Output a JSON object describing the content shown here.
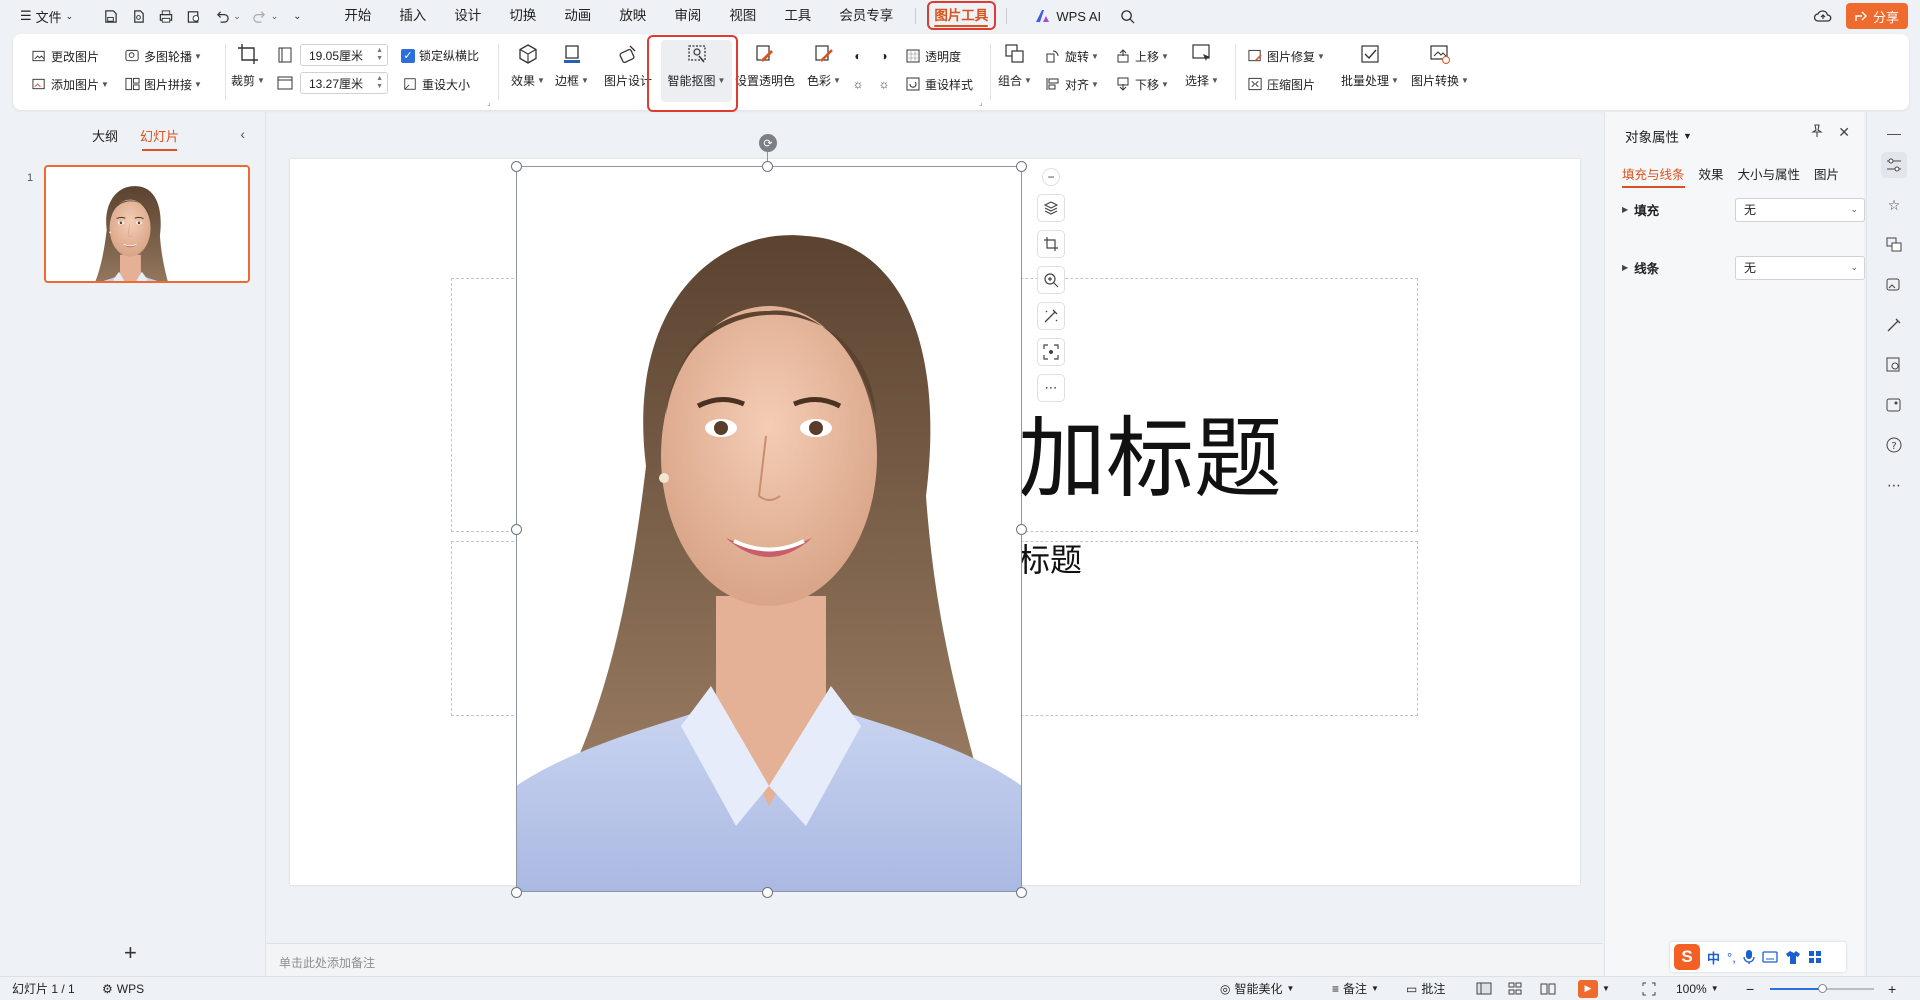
{
  "menubar": {
    "file_label": "文件",
    "tabs": [
      "开始",
      "插入",
      "设计",
      "切换",
      "动画",
      "放映",
      "审阅",
      "视图",
      "工具",
      "会员专享"
    ],
    "picture_tools_tab": "图片工具",
    "wps_ai_label": "WPS AI",
    "share_label": "分享"
  },
  "ribbon": {
    "change_picture": "更改图片",
    "add_picture": "添加图片",
    "multi_outline": "多图轮播",
    "picture_collage": "图片拼接",
    "crop": "裁剪",
    "width_value": "19.05厘米",
    "height_value": "13.27厘米",
    "lock_ratio": "锁定纵横比",
    "reset_size": "重设大小",
    "effects": "效果",
    "border": "边框",
    "picture_design": "图片设计",
    "smart_cutout": "智能抠图",
    "set_transparent_color": "设置透明色",
    "color": "色彩",
    "transparency": "透明度",
    "reset_style": "重设样式",
    "group": "组合",
    "rotate": "旋转",
    "align": "对齐",
    "bring_forward": "上移",
    "send_backward": "下移",
    "select": "选择",
    "picture_repair": "图片修复",
    "compress_picture": "压缩图片",
    "batch_process": "批量处理",
    "picture_convert": "图片转换"
  },
  "left_panel": {
    "tab_outline": "大纲",
    "tab_slides": "幻灯片",
    "slide_number": "1",
    "add_slide": "+"
  },
  "slide": {
    "title_visible": "加标题",
    "subtitle_visible": "标题"
  },
  "notes_placeholder": "单击此处添加备注",
  "right_panel": {
    "title": "对象属性",
    "tabs": [
      "填充与线条",
      "效果",
      "大小与属性",
      "图片"
    ],
    "fill_label": "填充",
    "fill_value": "无",
    "line_label": "线条",
    "line_value": "无"
  },
  "statusbar": {
    "slide_info": "幻灯片 1 / 1",
    "app_label": "WPS",
    "smart_beautify": "智能美化",
    "notes": "备注",
    "comments": "批注",
    "zoom": "100%",
    "zoom_fraction": 0.5
  },
  "ime": {
    "logo": "S",
    "lang": "中"
  },
  "colors": {
    "accent": "#d9531e",
    "share_bg": "#ee6a2d",
    "highlight_box": "#e03b30",
    "checkbox": "#2a6fdb"
  }
}
